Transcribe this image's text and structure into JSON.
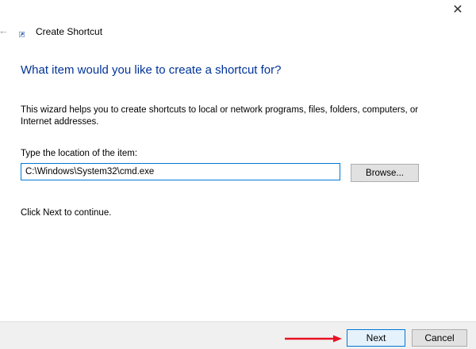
{
  "window": {
    "title": "Create Shortcut",
    "close_glyph": "✕",
    "back_glyph": "←"
  },
  "main": {
    "heading": "What item would you like to create a shortcut for?",
    "description": "This wizard helps you to create shortcuts to local or network programs, files, folders, computers, or Internet addresses.",
    "location_label": "Type the location of the item:",
    "location_value": "C:\\Windows\\System32\\cmd.exe",
    "browse_label": "Browse...",
    "continue_text": "Click Next to continue."
  },
  "footer": {
    "next_label": "Next",
    "cancel_label": "Cancel"
  },
  "icons": {
    "close": "close-icon",
    "back": "back-arrow-icon",
    "title": "shortcut-icon",
    "annotation": "red-arrow-icon"
  },
  "colors": {
    "heading": "#003399",
    "accent": "#0078d7",
    "annotation_arrow": "#e81123",
    "footer_bg": "#f0f0f0",
    "button_bg": "#e1e1e1"
  }
}
